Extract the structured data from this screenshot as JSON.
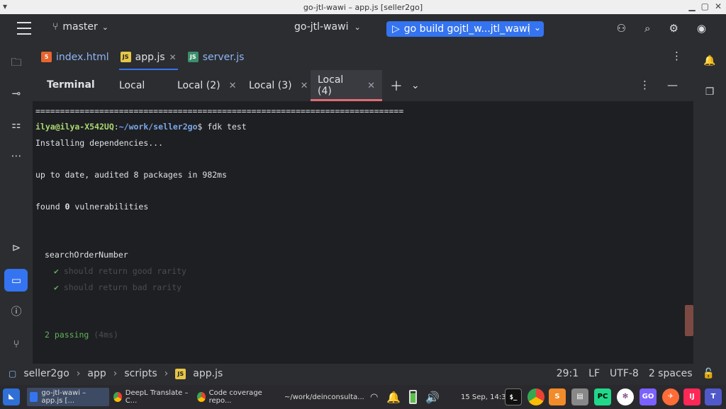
{
  "window": {
    "title": "go-jtl-wawi – app.js [seller2go]"
  },
  "toolbar": {
    "branch": "master",
    "project": "go-jtl-wawi",
    "run_config": "go build gojtl_w...jtl_wawi"
  },
  "editor_tabs": [
    {
      "label": "index.html",
      "icon": "html5-icon"
    },
    {
      "label": "app.js",
      "icon": "js-file-icon",
      "active": true
    },
    {
      "label": "server.js",
      "icon": "node-file-icon"
    }
  ],
  "terminal": {
    "title": "Terminal",
    "tabs": [
      {
        "label": "Local"
      },
      {
        "label": "Local (2)"
      },
      {
        "label": "Local (3)"
      },
      {
        "label": "Local (4)",
        "active": true
      }
    ],
    "lines": {
      "separator": "===========================================================================",
      "prompt_user": "ilya@ilya-X542UQ",
      "prompt_sep": ":",
      "prompt_path": "~/work/seller2go",
      "prompt_cmd": "$ fdk test",
      "installing": "Installing dependencies...",
      "audited": "up to date, audited 8 packages in 982ms",
      "found_pre": "found ",
      "found_num": "0",
      "found_post": " vulnerabilities",
      "suite": "searchOrderNumber",
      "check_mark": "✔",
      "test1": "should return good rarity",
      "test2": "should return bad rarity",
      "passing": "2 passing",
      "passing_time": "(4ms)"
    }
  },
  "statusbar": {
    "crumbs": [
      "seller2go",
      "app",
      "scripts",
      "app.js"
    ],
    "position": "29:1",
    "line_ending": "LF",
    "encoding": "UTF-8",
    "indent": "2 spaces"
  },
  "taskbar": {
    "items": [
      {
        "label": "go-jtl-wawi – app.js [..."
      },
      {
        "label": "DeepL Translate – C..."
      },
      {
        "label": "Code coverage repo..."
      },
      {
        "label": "~/work/deinconsulta..."
      }
    ],
    "clock": "15 Sep, 14:36",
    "apps": [
      "$_",
      "GO",
      "IJ"
    ]
  },
  "colors": {
    "accent": "#3574f0",
    "background": "#1e1f22",
    "panel": "#2b2d30",
    "prompt_user": "#a9d871",
    "prompt_path": "#7aa8e8",
    "success": "#5fb35a",
    "active_terminal_underline": "#e06c75"
  }
}
